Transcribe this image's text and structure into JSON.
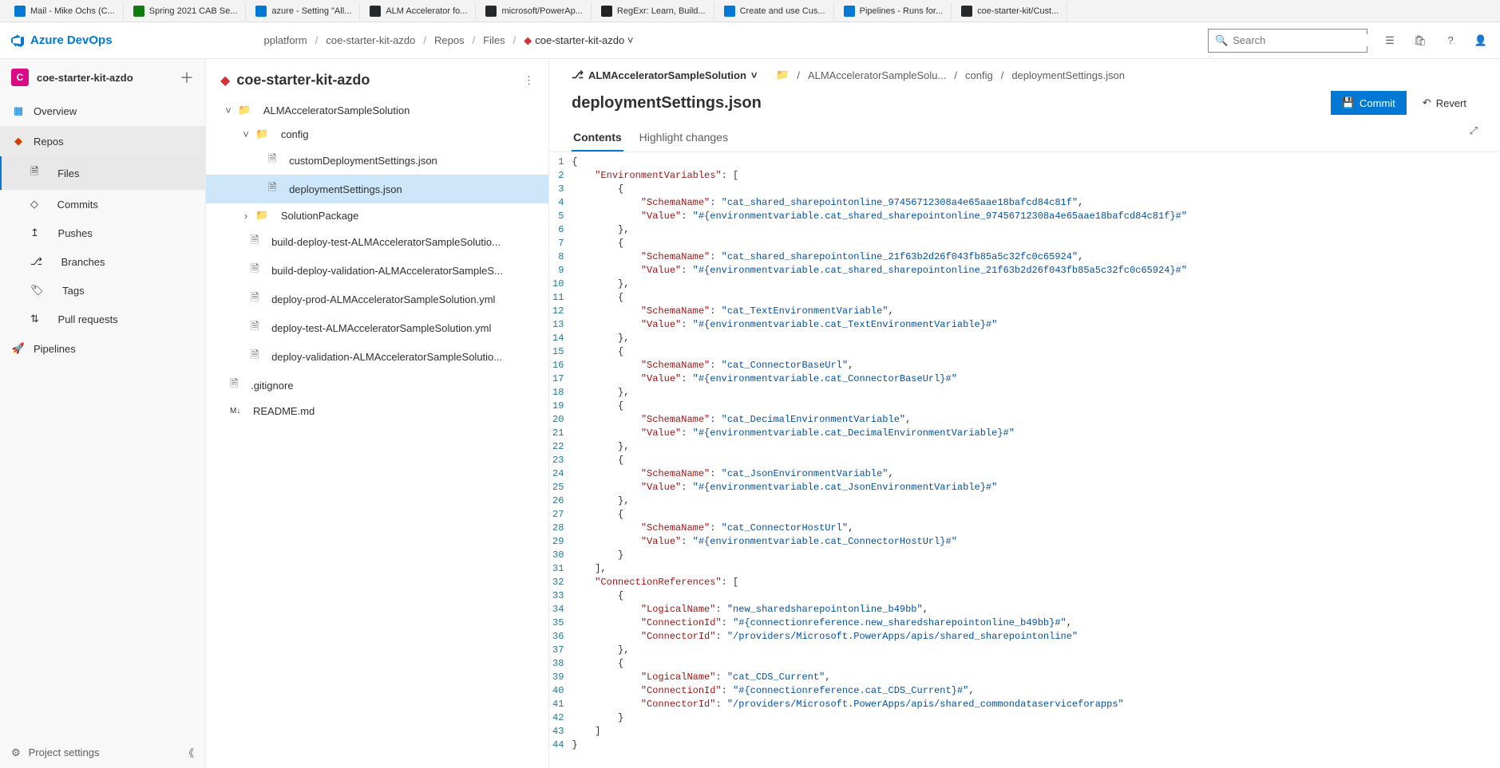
{
  "browserTabs": [
    {
      "label": "Mail - Mike Ochs (C...",
      "color": "#0078d4"
    },
    {
      "label": "Spring 2021 CAB Se...",
      "color": "#107c10"
    },
    {
      "label": "azure - Setting \"All...",
      "color": "#0078d4"
    },
    {
      "label": "ALM Accelerator fo...",
      "color": "#24292e"
    },
    {
      "label": "microsoft/PowerAp...",
      "color": "#24292e"
    },
    {
      "label": "RegExr: Learn, Build...",
      "color": "#222"
    },
    {
      "label": "Create and use Cus...",
      "color": "#0078d4"
    },
    {
      "label": "Pipelines - Runs for...",
      "color": "#0078d4"
    },
    {
      "label": "coe-starter-kit/Cust...",
      "color": "#24292e"
    }
  ],
  "app": {
    "name": "Azure DevOps"
  },
  "breadcrumbs": [
    "pplatform",
    "coe-starter-kit-azdo",
    "Repos",
    "Files",
    "coe-starter-kit-azdo"
  ],
  "searchPlaceholder": "Search",
  "project": {
    "badge": "C",
    "name": "coe-starter-kit-azdo"
  },
  "nav": {
    "overview": "Overview",
    "repos": "Repos",
    "files": "Files",
    "commits": "Commits",
    "pushes": "Pushes",
    "branches": "Branches",
    "tags": "Tags",
    "pullRequests": "Pull requests",
    "pipelines": "Pipelines",
    "projectSettings": "Project settings"
  },
  "explorer": {
    "repoName": "coe-starter-kit-azdo",
    "tree": {
      "folder1": "ALMAcceleratorSampleSolution",
      "folder2": "config",
      "file_custom": "customDeploymentSettings.json",
      "file_deploy": "deploymentSettings.json",
      "folder3": "SolutionPackage",
      "file_b1": "build-deploy-test-ALMAcceleratorSampleSolutio...",
      "file_b2": "build-deploy-validation-ALMAcceleratorSampleS...",
      "file_b3": "deploy-prod-ALMAcceleratorSampleSolution.yml",
      "file_b4": "deploy-test-ALMAcceleratorSampleSolution.yml",
      "file_b5": "deploy-validation-ALMAcceleratorSampleSolutio...",
      "gitignore": ".gitignore",
      "readme": "README.md"
    }
  },
  "content": {
    "branch": "ALMAcceleratorSampleSolution",
    "pathCrumbs": [
      "ALMAcceleratorSampleSolu...",
      "config",
      "deploymentSettings.json"
    ],
    "title": "deploymentSettings.json",
    "commit": "Commit",
    "revert": "Revert",
    "tabs": {
      "contents": "Contents",
      "highlight": "Highlight changes"
    }
  },
  "code": {
    "numLines": 44,
    "lines": [
      {
        "ind": 0,
        "t": [
          {
            "c": "brace",
            "v": "{"
          }
        ]
      },
      {
        "ind": 1,
        "t": [
          {
            "c": "key",
            "v": "\"EnvironmentVariables\""
          },
          {
            "c": "brace",
            "v": ": ["
          }
        ]
      },
      {
        "ind": 2,
        "t": [
          {
            "c": "brace",
            "v": "{"
          }
        ]
      },
      {
        "ind": 3,
        "t": [
          {
            "c": "key",
            "v": "\"SchemaName\""
          },
          {
            "c": "brace",
            "v": ": "
          },
          {
            "c": "str",
            "v": "\"cat_shared_sharepointonline_97456712308a4e65aae18bafcd84c81f\""
          },
          {
            "c": "brace",
            "v": ","
          }
        ]
      },
      {
        "ind": 3,
        "t": [
          {
            "c": "key",
            "v": "\"Value\""
          },
          {
            "c": "brace",
            "v": ": "
          },
          {
            "c": "str",
            "v": "\"#{environmentvariable.cat_shared_sharepointonline_97456712308a4e65aae18bafcd84c81f}#\""
          }
        ]
      },
      {
        "ind": 2,
        "t": [
          {
            "c": "brace",
            "v": "},"
          }
        ]
      },
      {
        "ind": 2,
        "t": [
          {
            "c": "brace",
            "v": "{"
          }
        ]
      },
      {
        "ind": 3,
        "t": [
          {
            "c": "key",
            "v": "\"SchemaName\""
          },
          {
            "c": "brace",
            "v": ": "
          },
          {
            "c": "str",
            "v": "\"cat_shared_sharepointonline_21f63b2d26f043fb85a5c32fc0c65924\""
          },
          {
            "c": "brace",
            "v": ","
          }
        ]
      },
      {
        "ind": 3,
        "t": [
          {
            "c": "key",
            "v": "\"Value\""
          },
          {
            "c": "brace",
            "v": ": "
          },
          {
            "c": "str",
            "v": "\"#{environmentvariable.cat_shared_sharepointonline_21f63b2d26f043fb85a5c32fc0c65924}#\""
          }
        ]
      },
      {
        "ind": 2,
        "t": [
          {
            "c": "brace",
            "v": "},"
          }
        ]
      },
      {
        "ind": 2,
        "t": [
          {
            "c": "brace",
            "v": "{"
          }
        ]
      },
      {
        "ind": 3,
        "t": [
          {
            "c": "key",
            "v": "\"SchemaName\""
          },
          {
            "c": "brace",
            "v": ": "
          },
          {
            "c": "str",
            "v": "\"cat_TextEnvironmentVariable\""
          },
          {
            "c": "brace",
            "v": ","
          }
        ]
      },
      {
        "ind": 3,
        "t": [
          {
            "c": "key",
            "v": "\"Value\""
          },
          {
            "c": "brace",
            "v": ": "
          },
          {
            "c": "str",
            "v": "\"#{environmentvariable.cat_TextEnvironmentVariable}#\""
          }
        ]
      },
      {
        "ind": 2,
        "t": [
          {
            "c": "brace",
            "v": "},"
          }
        ]
      },
      {
        "ind": 2,
        "t": [
          {
            "c": "brace",
            "v": "{"
          }
        ]
      },
      {
        "ind": 3,
        "t": [
          {
            "c": "key",
            "v": "\"SchemaName\""
          },
          {
            "c": "brace",
            "v": ": "
          },
          {
            "c": "str",
            "v": "\"cat_ConnectorBaseUrl\""
          },
          {
            "c": "brace",
            "v": ","
          }
        ]
      },
      {
        "ind": 3,
        "t": [
          {
            "c": "key",
            "v": "\"Value\""
          },
          {
            "c": "brace",
            "v": ": "
          },
          {
            "c": "str",
            "v": "\"#{environmentvariable.cat_ConnectorBaseUrl}#\""
          }
        ]
      },
      {
        "ind": 2,
        "t": [
          {
            "c": "brace",
            "v": "},"
          }
        ]
      },
      {
        "ind": 2,
        "t": [
          {
            "c": "brace",
            "v": "{"
          }
        ]
      },
      {
        "ind": 3,
        "t": [
          {
            "c": "key",
            "v": "\"SchemaName\""
          },
          {
            "c": "brace",
            "v": ": "
          },
          {
            "c": "str",
            "v": "\"cat_DecimalEnvironmentVariable\""
          },
          {
            "c": "brace",
            "v": ","
          }
        ]
      },
      {
        "ind": 3,
        "t": [
          {
            "c": "key",
            "v": "\"Value\""
          },
          {
            "c": "brace",
            "v": ": "
          },
          {
            "c": "str",
            "v": "\"#{environmentvariable.cat_DecimalEnvironmentVariable}#\""
          }
        ]
      },
      {
        "ind": 2,
        "t": [
          {
            "c": "brace",
            "v": "},"
          }
        ]
      },
      {
        "ind": 2,
        "t": [
          {
            "c": "brace",
            "v": "{"
          }
        ]
      },
      {
        "ind": 3,
        "t": [
          {
            "c": "key",
            "v": "\"SchemaName\""
          },
          {
            "c": "brace",
            "v": ": "
          },
          {
            "c": "str",
            "v": "\"cat_JsonEnvironmentVariable\""
          },
          {
            "c": "brace",
            "v": ","
          }
        ]
      },
      {
        "ind": 3,
        "t": [
          {
            "c": "key",
            "v": "\"Value\""
          },
          {
            "c": "brace",
            "v": ": "
          },
          {
            "c": "str",
            "v": "\"#{environmentvariable.cat_JsonEnvironmentVariable}#\""
          }
        ]
      },
      {
        "ind": 2,
        "t": [
          {
            "c": "brace",
            "v": "},"
          }
        ]
      },
      {
        "ind": 2,
        "t": [
          {
            "c": "brace",
            "v": "{"
          }
        ]
      },
      {
        "ind": 3,
        "t": [
          {
            "c": "key",
            "v": "\"SchemaName\""
          },
          {
            "c": "brace",
            "v": ": "
          },
          {
            "c": "str",
            "v": "\"cat_ConnectorHostUrl\""
          },
          {
            "c": "brace",
            "v": ","
          }
        ]
      },
      {
        "ind": 3,
        "t": [
          {
            "c": "key",
            "v": "\"Value\""
          },
          {
            "c": "brace",
            "v": ": "
          },
          {
            "c": "str",
            "v": "\"#{environmentvariable.cat_ConnectorHostUrl}#\""
          }
        ]
      },
      {
        "ind": 2,
        "t": [
          {
            "c": "brace",
            "v": "}"
          }
        ]
      },
      {
        "ind": 1,
        "t": [
          {
            "c": "brace",
            "v": "],"
          }
        ]
      },
      {
        "ind": 1,
        "t": [
          {
            "c": "key",
            "v": "\"ConnectionReferences\""
          },
          {
            "c": "brace",
            "v": ": ["
          }
        ]
      },
      {
        "ind": 2,
        "t": [
          {
            "c": "brace",
            "v": "{"
          }
        ]
      },
      {
        "ind": 3,
        "t": [
          {
            "c": "key",
            "v": "\"LogicalName\""
          },
          {
            "c": "brace",
            "v": ": "
          },
          {
            "c": "str",
            "v": "\"new_sharedsharepointonline_b49bb\""
          },
          {
            "c": "brace",
            "v": ","
          }
        ]
      },
      {
        "ind": 3,
        "t": [
          {
            "c": "key",
            "v": "\"ConnectionId\""
          },
          {
            "c": "brace",
            "v": ": "
          },
          {
            "c": "str",
            "v": "\"#{connectionreference.new_sharedsharepointonline_b49bb}#\""
          },
          {
            "c": "brace",
            "v": ","
          }
        ]
      },
      {
        "ind": 3,
        "t": [
          {
            "c": "key",
            "v": "\"ConnectorId\""
          },
          {
            "c": "brace",
            "v": ": "
          },
          {
            "c": "str",
            "v": "\"/providers/Microsoft.PowerApps/apis/shared_sharepointonline\""
          }
        ]
      },
      {
        "ind": 2,
        "t": [
          {
            "c": "brace",
            "v": "},"
          }
        ]
      },
      {
        "ind": 2,
        "t": [
          {
            "c": "brace",
            "v": "{"
          }
        ]
      },
      {
        "ind": 3,
        "t": [
          {
            "c": "key",
            "v": "\"LogicalName\""
          },
          {
            "c": "brace",
            "v": ": "
          },
          {
            "c": "str",
            "v": "\"cat_CDS_Current\""
          },
          {
            "c": "brace",
            "v": ","
          }
        ]
      },
      {
        "ind": 3,
        "t": [
          {
            "c": "key",
            "v": "\"ConnectionId\""
          },
          {
            "c": "brace",
            "v": ": "
          },
          {
            "c": "str",
            "v": "\"#{connectionreference.cat_CDS_Current}#\""
          },
          {
            "c": "brace",
            "v": ","
          }
        ]
      },
      {
        "ind": 3,
        "t": [
          {
            "c": "key",
            "v": "\"ConnectorId\""
          },
          {
            "c": "brace",
            "v": ": "
          },
          {
            "c": "str",
            "v": "\"/providers/Microsoft.PowerApps/apis/shared_commondataserviceforapps\""
          }
        ]
      },
      {
        "ind": 2,
        "t": [
          {
            "c": "brace",
            "v": "}"
          }
        ]
      },
      {
        "ind": 1,
        "t": [
          {
            "c": "brace",
            "v": "]"
          }
        ]
      },
      {
        "ind": 0,
        "t": [
          {
            "c": "brace",
            "v": "}"
          }
        ]
      }
    ]
  }
}
